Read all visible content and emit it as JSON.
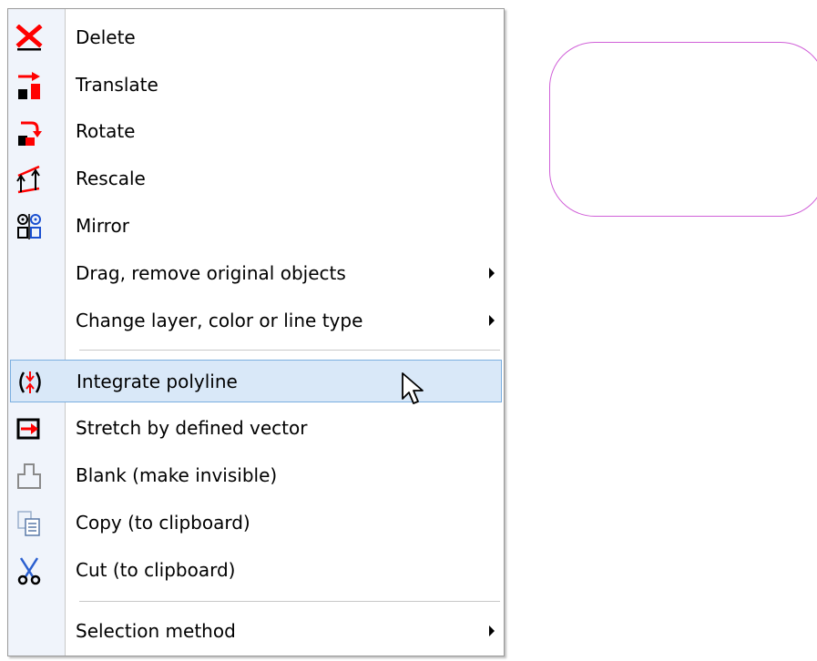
{
  "menu": {
    "items": [
      {
        "label": "Delete",
        "icon": "delete-x-icon"
      },
      {
        "label": "Translate",
        "icon": "translate-icon"
      },
      {
        "label": "Rotate",
        "icon": "rotate-icon"
      },
      {
        "label": "Rescale",
        "icon": "rescale-icon"
      },
      {
        "label": "Mirror",
        "icon": "mirror-icon"
      },
      {
        "label": "Drag, remove original objects",
        "submenu": true
      },
      {
        "label": "Change layer, color or line type",
        "submenu": true
      },
      {
        "label": "Integrate polyline",
        "icon": "integrate-polyline-icon",
        "highlighted": true
      },
      {
        "label": "Stretch by defined vector",
        "icon": "stretch-icon"
      },
      {
        "label": "Blank (make invisible)",
        "icon": "blank-icon"
      },
      {
        "label": "Copy (to clipboard)",
        "icon": "copy-icon"
      },
      {
        "label": "Cut (to clipboard)",
        "icon": "cut-scissors-icon"
      },
      {
        "label": "Selection method",
        "submenu": true
      }
    ]
  },
  "colors": {
    "highlight_bg": "#d9e8f8",
    "highlight_border": "#7aaee0",
    "shape_stroke": "#d060d8",
    "icon_red": "#ff0000"
  }
}
